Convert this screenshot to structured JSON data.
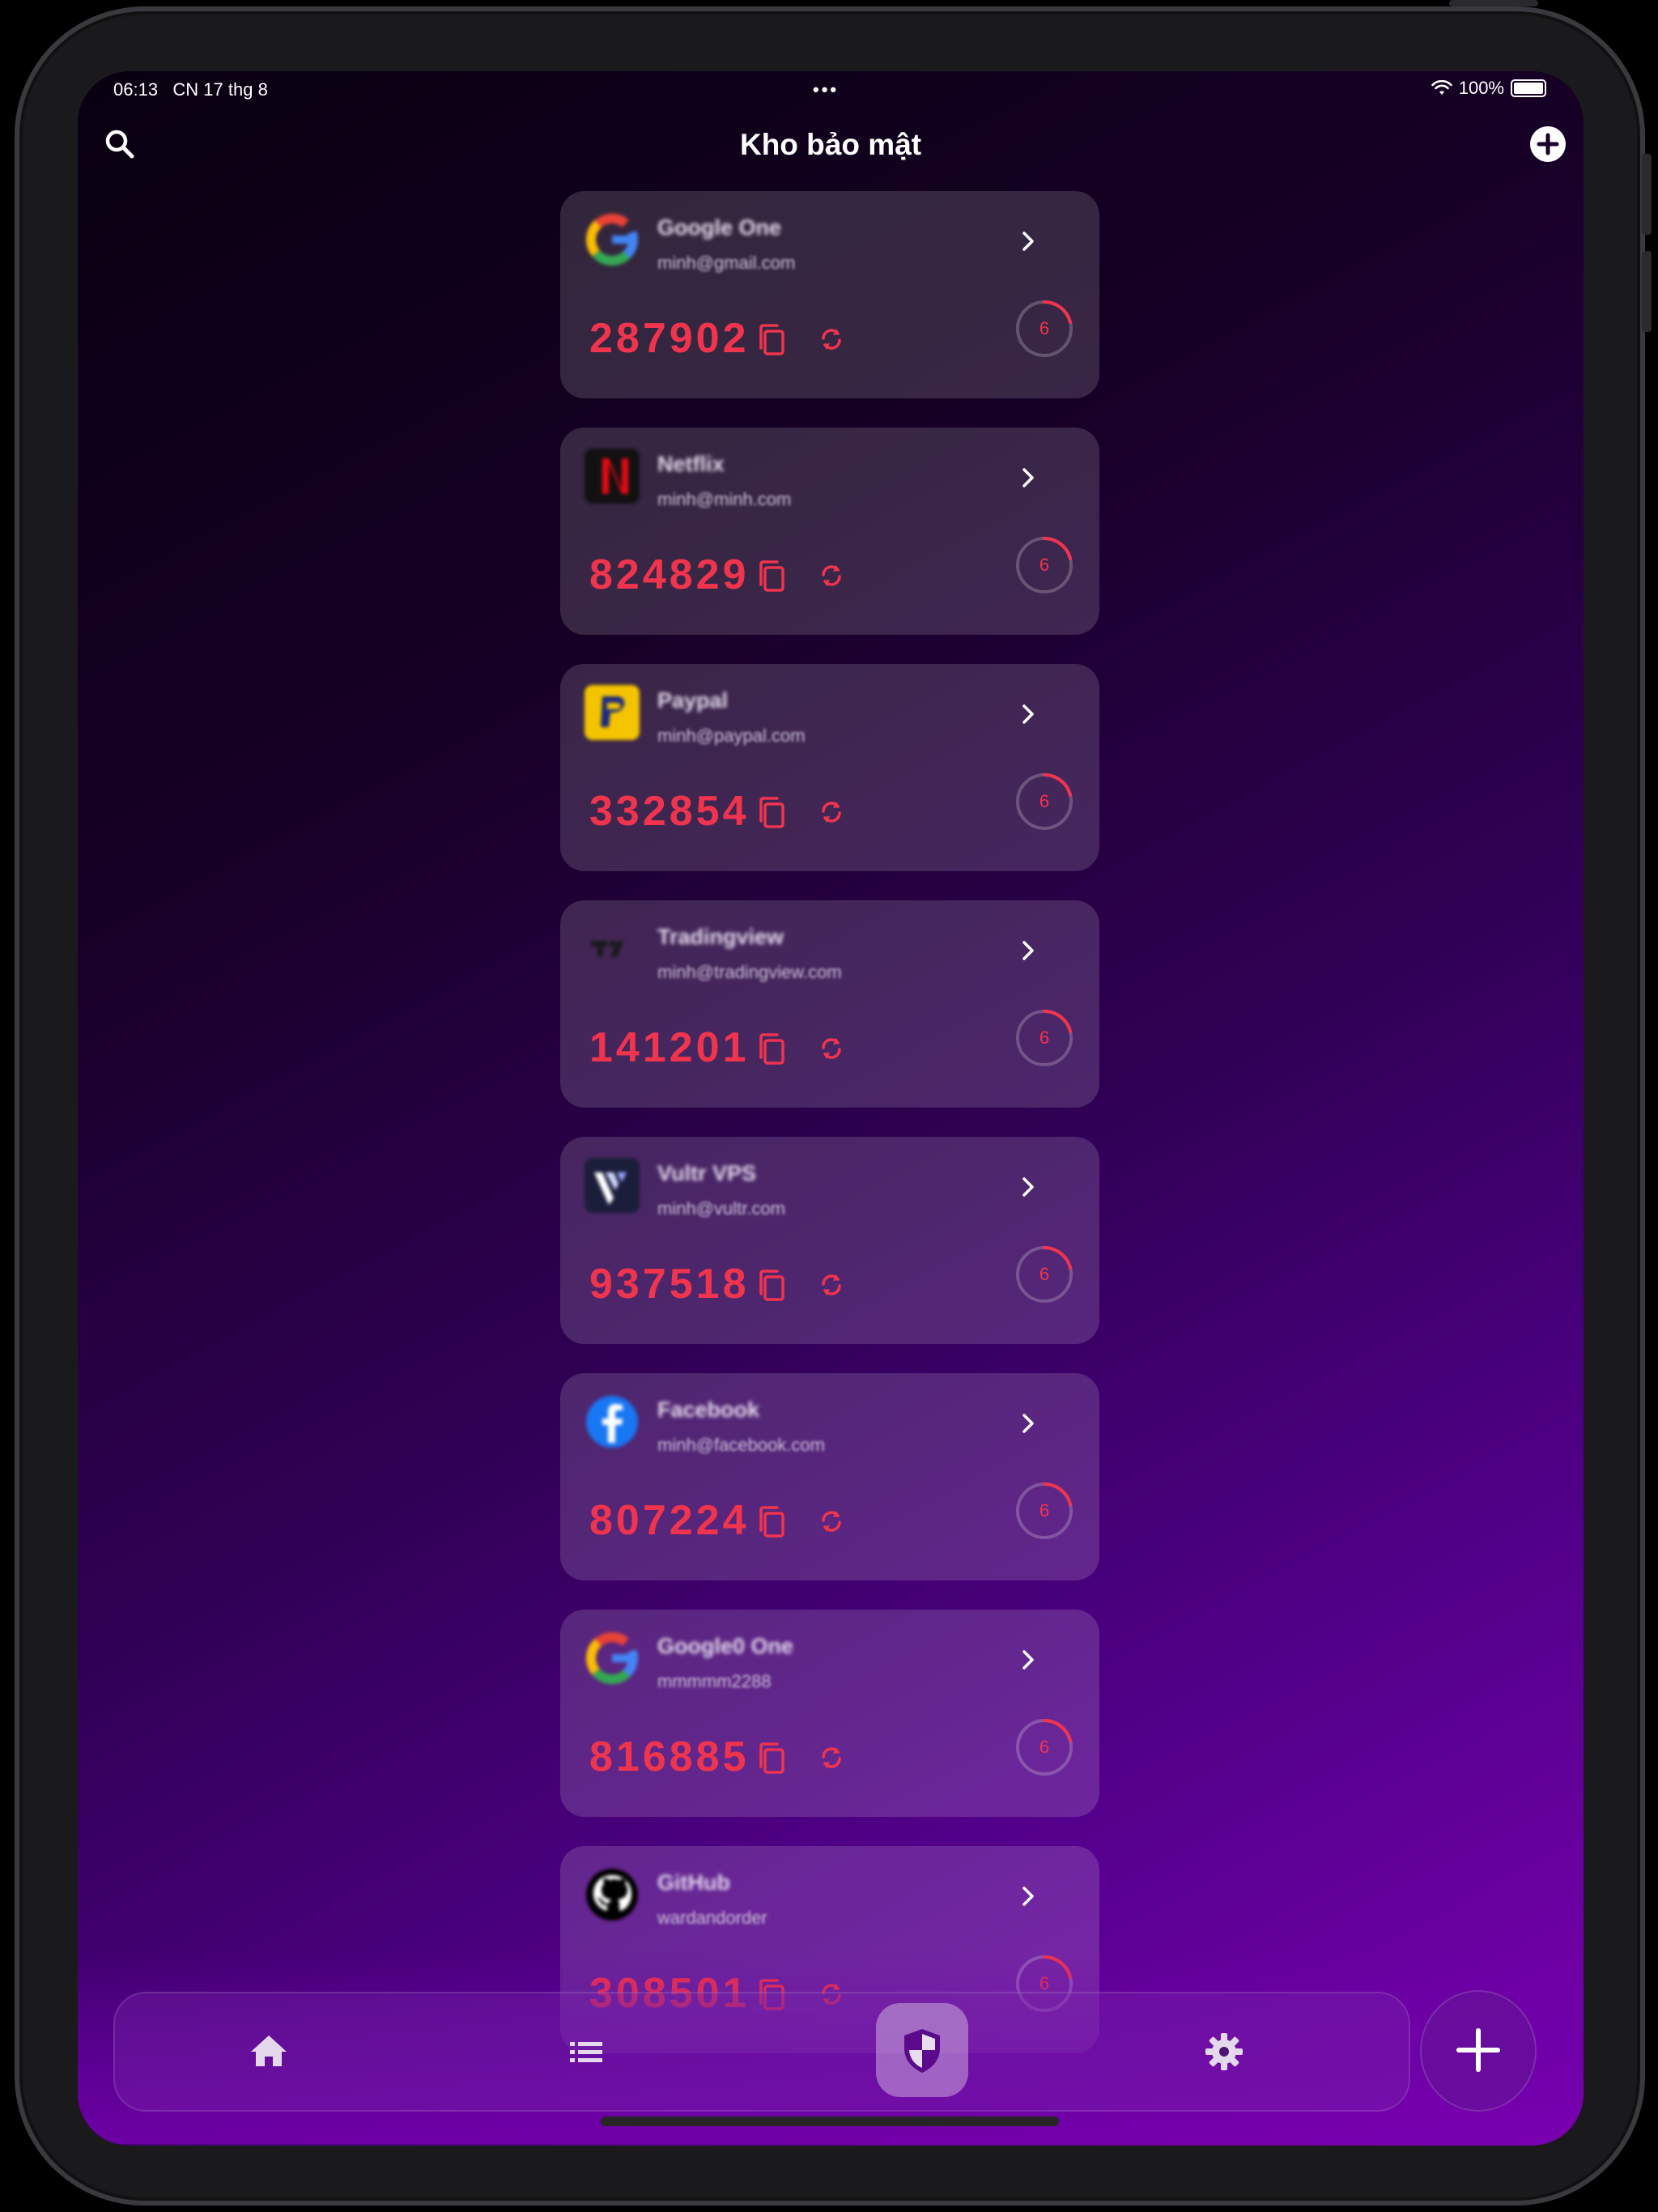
{
  "status_bar": {
    "time": "06:13",
    "date": "CN 17 thg 8",
    "multitask": "•••",
    "battery": "100%"
  },
  "header": {
    "title": "Kho bảo mật",
    "search_icon": "search-icon",
    "add_icon": "plus-circle-icon"
  },
  "accent_color": "#f0344e",
  "accounts": [
    {
      "name": "Google One",
      "email": "minh@gmail.com",
      "code": "287902",
      "timer": "6",
      "logo": "google"
    },
    {
      "name": "Netflix",
      "email": "minh@minh.com",
      "code": "824829",
      "timer": "6",
      "logo": "netflix"
    },
    {
      "name": "Paypal",
      "email": "minh@paypal.com",
      "code": "332854",
      "timer": "6",
      "logo": "paypal"
    },
    {
      "name": "Tradingview",
      "email": "minh@tradingview.com",
      "code": "141201",
      "timer": "6",
      "logo": "tradingview"
    },
    {
      "name": "Vultr VPS",
      "email": "minh@vultr.com",
      "code": "937518",
      "timer": "6",
      "logo": "vultr"
    },
    {
      "name": "Facebook",
      "email": "minh@facebook.com",
      "code": "807224",
      "timer": "6",
      "logo": "facebook"
    },
    {
      "name": "Google0 One",
      "email": "mmmmm2288",
      "code": "816885",
      "timer": "6",
      "logo": "google"
    },
    {
      "name": "GitHub",
      "email": "wardandorder",
      "code": "308501",
      "timer": "6",
      "logo": "github"
    }
  ],
  "tabbar": {
    "tabs": [
      {
        "icon": "home-icon",
        "active": false
      },
      {
        "icon": "list-icon",
        "active": false
      },
      {
        "icon": "shield-icon",
        "active": true
      },
      {
        "icon": "gear-icon",
        "active": false
      }
    ],
    "fab_icon": "plus-icon"
  }
}
